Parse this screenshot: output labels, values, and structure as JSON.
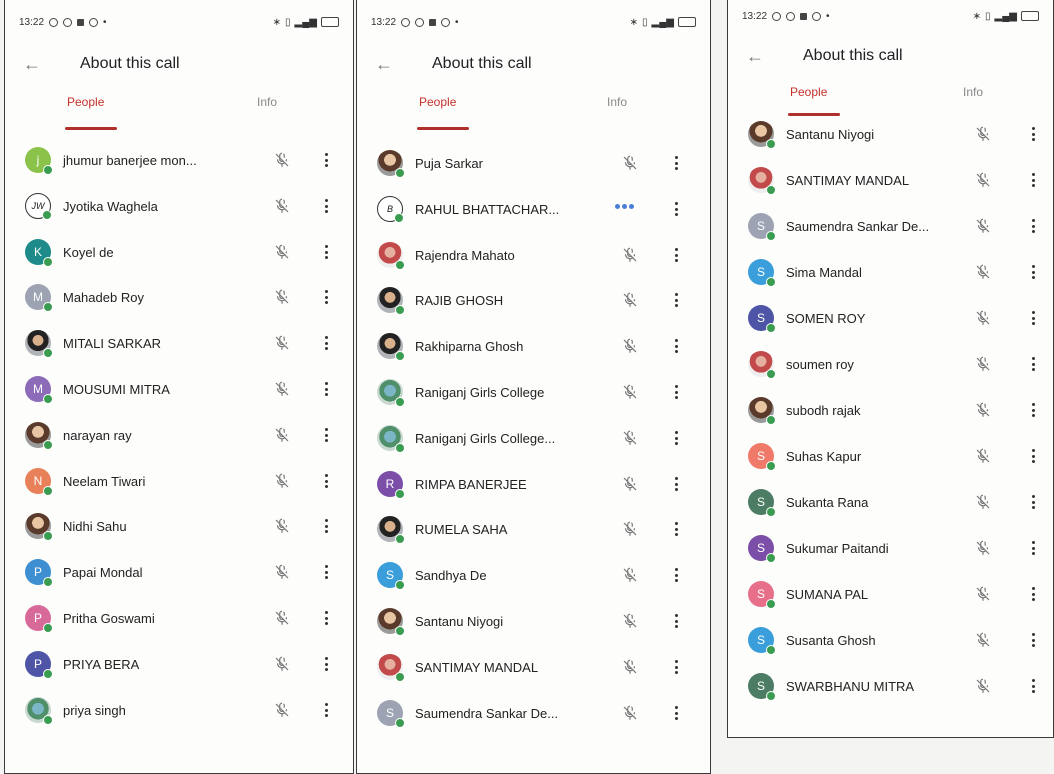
{
  "colors": {
    "accent": "#c5302b",
    "online": "#3a9c50",
    "teal": "#1e8a8a",
    "violet": "#8c6bb8",
    "gray": "#9da3b2",
    "orange": "#e8805a",
    "pink": "#d86a9a",
    "indigo": "#4f55a6",
    "blue": "#3d8fd1",
    "lime": "#8bc34a",
    "green": "#4d7c64",
    "purple": "#7b4ea8",
    "lightblue": "#3a9edb",
    "rose": "#e76f8a",
    "coral": "#f07a6a"
  },
  "panels": [
    {
      "status": {
        "time": "13:22"
      },
      "header": {
        "back": "←",
        "title": "About this call"
      },
      "tabs": {
        "people": "People",
        "info": "Info"
      },
      "participants": [
        {
          "name": "jhumur banerjee mon...",
          "initial": "j",
          "avatar": "lime",
          "status": "muted"
        },
        {
          "name": "Jyotika Waghela",
          "initial": "JW",
          "avatar": "outline",
          "status": "muted"
        },
        {
          "name": "Koyel de",
          "initial": "K",
          "avatar": "teal",
          "status": "muted"
        },
        {
          "name": "Mahadeb Roy",
          "initial": "M",
          "avatar": "gray",
          "status": "muted"
        },
        {
          "name": "MITALI SARKAR",
          "initial": "",
          "avatar": "photo2",
          "status": "muted"
        },
        {
          "name": "MOUSUMI MITRA",
          "initial": "M",
          "avatar": "violet",
          "status": "muted"
        },
        {
          "name": "narayan ray",
          "initial": "",
          "avatar": "photo",
          "status": "muted"
        },
        {
          "name": "Neelam Tiwari",
          "initial": "N",
          "avatar": "orange",
          "status": "muted"
        },
        {
          "name": "Nidhi Sahu",
          "initial": "",
          "avatar": "photo",
          "status": "muted"
        },
        {
          "name": "Papai Mondal",
          "initial": "P",
          "avatar": "blue",
          "status": "muted"
        },
        {
          "name": "Pritha Goswami",
          "initial": "P",
          "avatar": "pink",
          "status": "muted"
        },
        {
          "name": "PRIYA BERA",
          "initial": "P",
          "avatar": "indigo",
          "status": "muted"
        },
        {
          "name": "priya singh",
          "initial": "",
          "avatar": "photo3",
          "status": "muted"
        }
      ]
    },
    {
      "status": {
        "time": "13:22"
      },
      "header": {
        "back": "←",
        "title": "About this call"
      },
      "tabs": {
        "people": "People",
        "info": "Info"
      },
      "participants": [
        {
          "name": "Puja Sarkar",
          "initial": "",
          "avatar": "photo",
          "status": "muted"
        },
        {
          "name": "RAHUL BHATTACHAR...",
          "initial": "B",
          "avatar": "outline",
          "status": "speaking"
        },
        {
          "name": "Rajendra Mahato",
          "initial": "",
          "avatar": "photo4",
          "status": "muted"
        },
        {
          "name": "RAJIB GHOSH",
          "initial": "",
          "avatar": "photo2",
          "status": "muted"
        },
        {
          "name": "Rakhiparna Ghosh",
          "initial": "",
          "avatar": "photo2",
          "status": "muted"
        },
        {
          "name": "Raniganj Girls College",
          "initial": "",
          "avatar": "photo3",
          "status": "muted"
        },
        {
          "name": "Raniganj Girls College...",
          "initial": "",
          "avatar": "photo3",
          "status": "muted"
        },
        {
          "name": "RIMPA BANERJEE",
          "initial": "R",
          "avatar": "purple",
          "status": "muted"
        },
        {
          "name": "RUMELA SAHA",
          "initial": "",
          "avatar": "photo2",
          "status": "muted"
        },
        {
          "name": "Sandhya De",
          "initial": "S",
          "avatar": "lightblue",
          "status": "muted"
        },
        {
          "name": "Santanu Niyogi",
          "initial": "",
          "avatar": "photo",
          "status": "muted"
        },
        {
          "name": "SANTIMAY MANDAL",
          "initial": "",
          "avatar": "photo4",
          "status": "muted"
        },
        {
          "name": "Saumendra Sankar De...",
          "initial": "S",
          "avatar": "gray",
          "status": "muted"
        }
      ]
    },
    {
      "status": {
        "time": "13:22"
      },
      "header": {
        "back": "←",
        "title": "About this call"
      },
      "tabs": {
        "people": "People",
        "info": "Info"
      },
      "participants": [
        {
          "name": "Santanu Niyogi",
          "initial": "",
          "avatar": "photo",
          "status": "muted"
        },
        {
          "name": "SANTIMAY MANDAL",
          "initial": "",
          "avatar": "photo4",
          "status": "muted"
        },
        {
          "name": "Saumendra Sankar De...",
          "initial": "S",
          "avatar": "gray",
          "status": "muted"
        },
        {
          "name": "Sima Mandal",
          "initial": "S",
          "avatar": "lightblue",
          "status": "muted"
        },
        {
          "name": "SOMEN ROY",
          "initial": "S",
          "avatar": "indigo",
          "status": "muted"
        },
        {
          "name": "soumen roy",
          "initial": "",
          "avatar": "photo4",
          "status": "muted"
        },
        {
          "name": "subodh rajak",
          "initial": "",
          "avatar": "photo",
          "status": "muted"
        },
        {
          "name": "Suhas Kapur",
          "initial": "S",
          "avatar": "coral",
          "status": "muted"
        },
        {
          "name": "Sukanta Rana",
          "initial": "S",
          "avatar": "green",
          "status": "muted"
        },
        {
          "name": "Sukumar Paitandi",
          "initial": "S",
          "avatar": "purple",
          "status": "muted"
        },
        {
          "name": "SUMANA PAL",
          "initial": "S",
          "avatar": "rose",
          "status": "muted"
        },
        {
          "name": "Susanta Ghosh",
          "initial": "S",
          "avatar": "lightblue",
          "status": "muted"
        },
        {
          "name": "SWARBHANU MITRA",
          "initial": "S",
          "avatar": "green",
          "status": "muted"
        }
      ]
    }
  ]
}
